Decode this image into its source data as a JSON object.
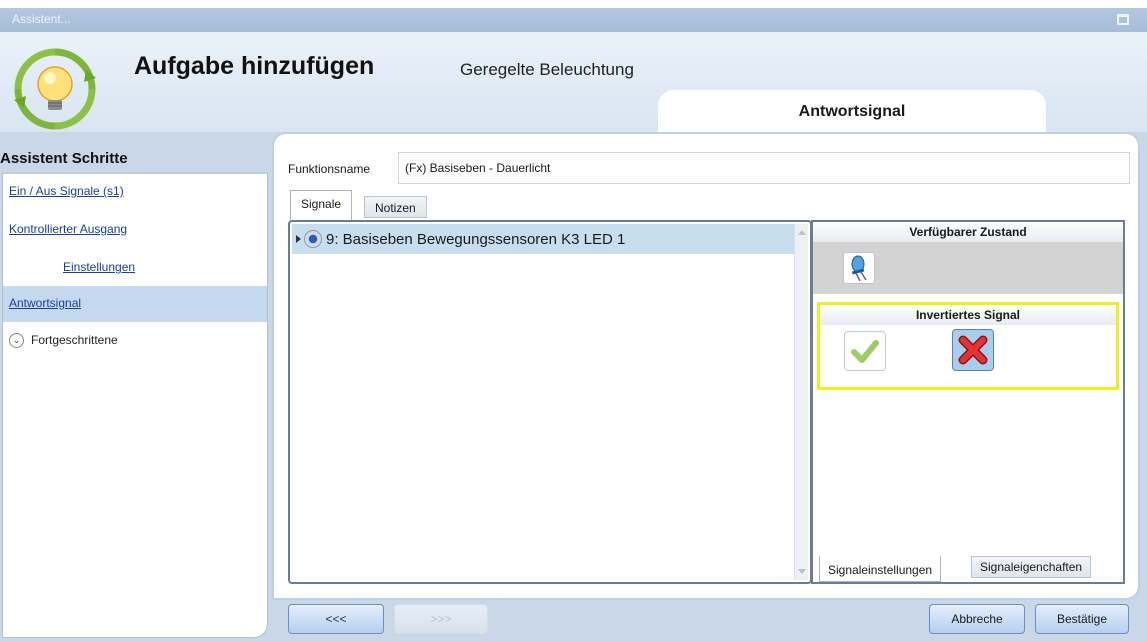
{
  "window": {
    "title": "Assistent..."
  },
  "header": {
    "title": "Aufgabe hinzufügen",
    "subtitle": "Geregelte Beleuchtung",
    "current_step": "Antwortsignal"
  },
  "sidebar": {
    "heading": "Assistent Schritte",
    "items": [
      {
        "label": "Ein / Aus Signale (s1)"
      },
      {
        "label": "Kontrollierter Ausgang"
      },
      {
        "label": "Einstellungen"
      },
      {
        "label": "Antwortsignal"
      },
      {
        "label": "Fortgeschrittene"
      }
    ]
  },
  "main": {
    "function_name_label": "Funktionsname",
    "function_name_value": "(Fx) Basiseben - Dauerlicht",
    "tabs": [
      {
        "label": "Signale"
      },
      {
        "label": "Notizen"
      }
    ],
    "signals": [
      {
        "label": "9: Basiseben Bewegungssensoren K3 LED 1"
      }
    ]
  },
  "right_panel": {
    "available_state_title": "Verfügbarer Zustand",
    "inverted_signal_title": "Invertiertes Signal",
    "tabs": [
      {
        "label": "Signaleinstellungen"
      },
      {
        "label": "Signaleigenchaften"
      }
    ]
  },
  "footer": {
    "prev_label": "<<<",
    "next_label": ">>>",
    "cancel_label": "Abbreche",
    "confirm_label": "Bestätige"
  },
  "colors": {
    "highlight": "#f2ee1a",
    "selection": "#c6deee",
    "link": "#1a3fa0"
  },
  "icons": [
    "lightbulb-logo-icon",
    "maximize-icon",
    "chevron-down-icon",
    "expand-arrow-icon",
    "sensor-icon",
    "led-icon",
    "check-icon",
    "x-icon"
  ]
}
